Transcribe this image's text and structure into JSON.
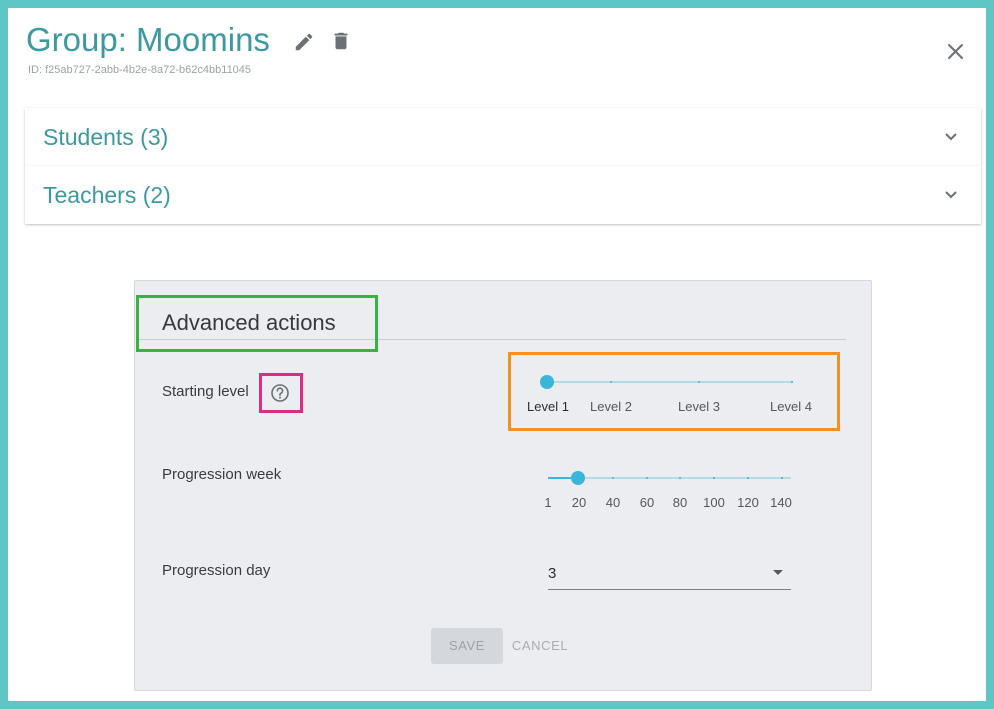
{
  "header": {
    "title": "Group: Moomins",
    "group_id": "ID: f25ab727-2abb-4b2e-8a72-b62c4bb11045",
    "edit_icon": "pencil-icon",
    "delete_icon": "trash-icon",
    "close_icon": "close-icon"
  },
  "sections": [
    {
      "label": "Students (3)",
      "icon": "chevron-down-icon"
    },
    {
      "label": "Teachers (2)",
      "icon": "chevron-down-icon"
    }
  ],
  "advanced": {
    "title": "Advanced actions",
    "starting_level": {
      "label": "Starting level",
      "help_icon": "help-circle-icon",
      "marks": [
        "Level 1",
        "Level 2",
        "Level 3",
        "Level 4"
      ],
      "selected": "Level 1"
    },
    "progression_week": {
      "label": "Progression week",
      "marks": [
        "1",
        "20",
        "40",
        "60",
        "80",
        "100",
        "120",
        "140"
      ],
      "min": 1,
      "max": 140,
      "value": 20
    },
    "progression_day": {
      "label": "Progression day",
      "value": "3",
      "icon": "caret-down-icon"
    },
    "save_label": "SAVE",
    "cancel_label": "CANCEL"
  },
  "colors": {
    "frame": "#5fc6c6",
    "accent_teal": "#3a9aa0",
    "slider": "#39b6da",
    "highlight_green": "#3cb043",
    "highlight_pink": "#e02a86",
    "highlight_orange": "#f39020"
  }
}
